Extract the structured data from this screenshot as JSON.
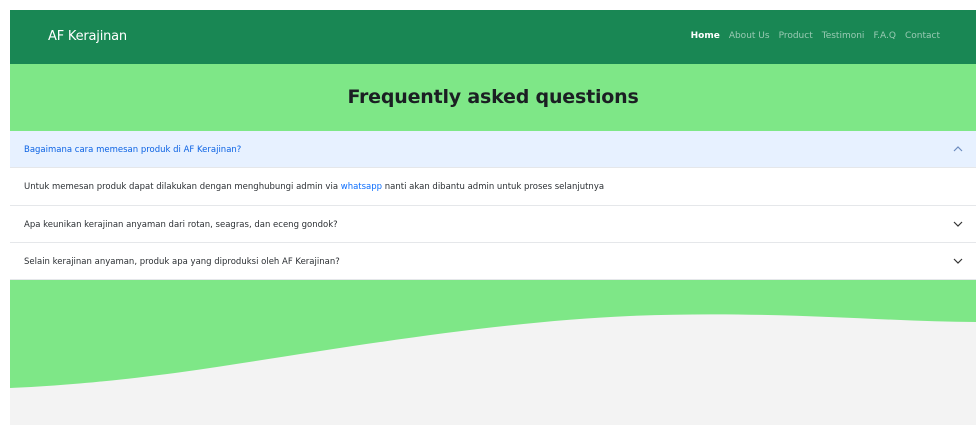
{
  "navbar": {
    "brand": "AF Kerajinan",
    "links": [
      "Home",
      "About Us",
      "Product",
      "Testimoni",
      "F.A.Q",
      "Contact"
    ],
    "active": "Home"
  },
  "faq": {
    "title": "Frequently asked questions",
    "items": [
      {
        "question": "Bagaimana cara memesan produk di AF Kerajinan?",
        "expanded": true,
        "answer_before": "Untuk memesan produk dapat dilakukan dengan menghubungi admin via ",
        "answer_link": "whatsapp",
        "answer_after": " nanti akan dibantu admin untuk proses selanjutnya"
      },
      {
        "question": "Apa keunikan kerajinan anyaman dari rotan, seagras, dan eceng gondok?",
        "expanded": false
      },
      {
        "question": "Selain kerajinan anyaman, produk apa yang diproduksi oleh AF Kerajinan?",
        "expanded": false
      }
    ]
  },
  "colors": {
    "navbar": "#198754",
    "band": "#7ee787",
    "open_header": "#e7f1ff",
    "link": "#0d6efd",
    "page_bg": "#f3f3f3"
  }
}
